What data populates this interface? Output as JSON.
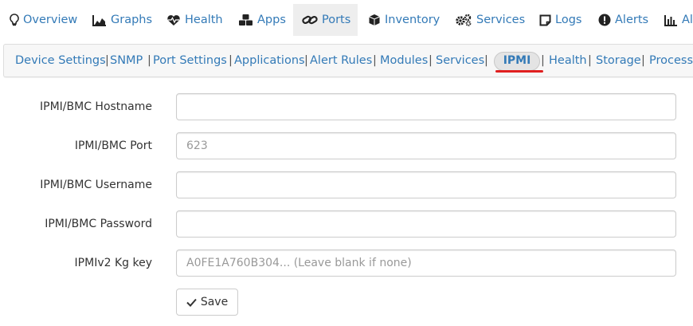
{
  "top_nav": {
    "tabs": [
      {
        "label": "Overview",
        "icon": "lightbulb-icon"
      },
      {
        "label": "Graphs",
        "icon": "area-chart-icon"
      },
      {
        "label": "Health",
        "icon": "heartbeat-icon"
      },
      {
        "label": "Apps",
        "icon": "cubes-icon"
      },
      {
        "label": "Ports",
        "icon": "link-icon",
        "active": true
      },
      {
        "label": "Inventory",
        "icon": "cube-icon"
      },
      {
        "label": "Services",
        "icon": "cogs-icon"
      },
      {
        "label": "Logs",
        "icon": "sticky-note-icon"
      },
      {
        "label": "Alerts",
        "icon": "exclamation-circle-icon"
      },
      {
        "label": "Ale",
        "icon": "bar-chart-icon"
      }
    ]
  },
  "sub_nav": {
    "items": [
      {
        "label": "Device Settings"
      },
      {
        "label": "SNMP"
      },
      {
        "label": "Port Settings"
      },
      {
        "label": "Applications"
      },
      {
        "label": "Alert Rules"
      },
      {
        "label": "Modules"
      },
      {
        "label": "Services"
      },
      {
        "label": "IPMI",
        "active": true
      },
      {
        "label": "Health"
      },
      {
        "label": "Storage"
      },
      {
        "label": "Processo"
      }
    ],
    "separator": "|"
  },
  "form": {
    "fields": [
      {
        "label": "IPMI/BMC Hostname",
        "value": "",
        "placeholder": ""
      },
      {
        "label": "IPMI/BMC Port",
        "value": "",
        "placeholder": "623"
      },
      {
        "label": "IPMI/BMC Username",
        "value": "",
        "placeholder": ""
      },
      {
        "label": "IPMI/BMC Password",
        "value": "",
        "placeholder": ""
      },
      {
        "label": "IPMIv2 Kg key",
        "value": "",
        "placeholder": "A0FE1A760B304... (Leave blank if none)"
      }
    ],
    "save_label": "Save"
  },
  "colors": {
    "link": "#337ab7",
    "active_tab_bg": "#eeeeee",
    "subnav_bg": "#f7f7f7",
    "highlight_underline": "#e02020"
  }
}
